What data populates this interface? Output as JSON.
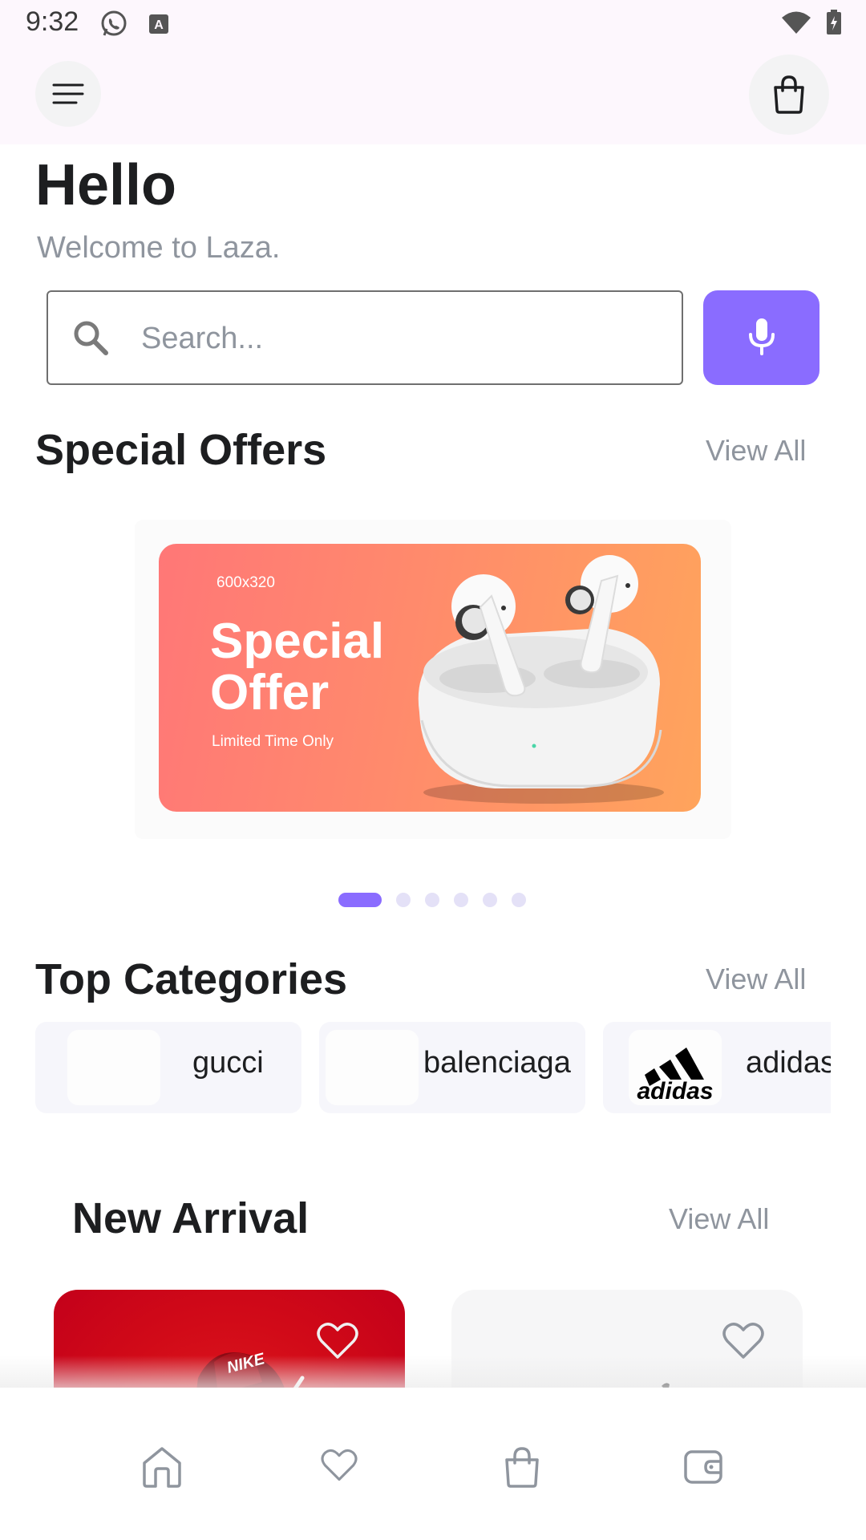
{
  "status_bar": {
    "time": "9:32",
    "left_icons": [
      "whatsapp-icon",
      "keyboard-a-icon"
    ],
    "right_icons": [
      "wifi-icon",
      "battery-icon"
    ]
  },
  "header": {
    "menu_icon": "menu-icon",
    "bag_icon": "shopping-bag-icon"
  },
  "greeting": {
    "title": "Hello",
    "subtitle": "Welcome to Laza."
  },
  "search": {
    "placeholder": "Search...",
    "value": "",
    "icon": "search-icon",
    "voice_icon": "microphone-icon"
  },
  "special_offers": {
    "title": "Special Offers",
    "view_all": "View All",
    "banner": {
      "size_label": "600x320",
      "title": "Special Offer",
      "subtitle": "Limited Time Only"
    },
    "carousel": {
      "count": 6,
      "active": 0
    }
  },
  "top_categories": {
    "title": "Top Categories",
    "view_all": "View All",
    "items": [
      {
        "name": "gucci"
      },
      {
        "name": "balenciaga"
      },
      {
        "name": "adidas",
        "logo_text": "adidas"
      }
    ]
  },
  "new_arrival": {
    "title": "New Arrival",
    "view_all": "View All",
    "products": [
      {
        "brand_text": "NIKE",
        "favorite": false
      },
      {
        "favorite": false
      }
    ]
  },
  "bottom_nav": {
    "items": [
      "home-icon",
      "heart-icon",
      "bag-icon",
      "wallet-icon"
    ]
  },
  "colors": {
    "accent": "#8a6cff",
    "text_primary": "#1d1e20",
    "text_secondary": "#8f959e",
    "header_bg": "#fdf7fd"
  }
}
